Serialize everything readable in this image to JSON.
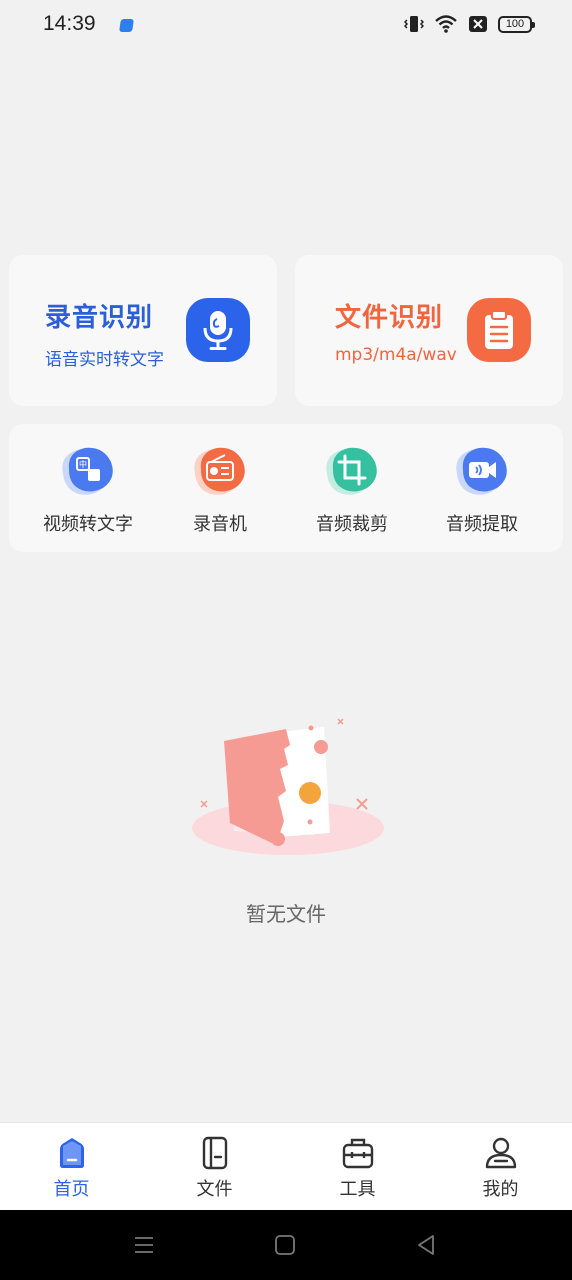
{
  "status": {
    "time": "14:39",
    "battery": "100"
  },
  "cards": {
    "record": {
      "title": "录音识别",
      "subtitle": "语音实时转文字",
      "icon": "microphone-icon",
      "color": "#2b5fd9"
    },
    "file": {
      "title": "文件识别",
      "subtitle": "mp3/m4a/wav",
      "icon": "clipboard-icon",
      "color": "#f2643c"
    }
  },
  "tools": [
    {
      "label": "视频转文字",
      "icon": "translate-icon",
      "color": "#4a79f0"
    },
    {
      "label": "录音机",
      "icon": "radio-icon",
      "color": "#f46a43"
    },
    {
      "label": "音频裁剪",
      "icon": "crop-icon",
      "color": "#35c0a0"
    },
    {
      "label": "音频提取",
      "icon": "video-audio-icon",
      "color": "#4a79f0"
    }
  ],
  "empty": {
    "text": "暂无文件"
  },
  "nav": [
    {
      "label": "首页",
      "icon": "home-icon",
      "active": true
    },
    {
      "label": "文件",
      "icon": "file-icon",
      "active": false
    },
    {
      "label": "工具",
      "icon": "toolbox-icon",
      "active": false
    },
    {
      "label": "我的",
      "icon": "user-icon",
      "active": false
    }
  ]
}
